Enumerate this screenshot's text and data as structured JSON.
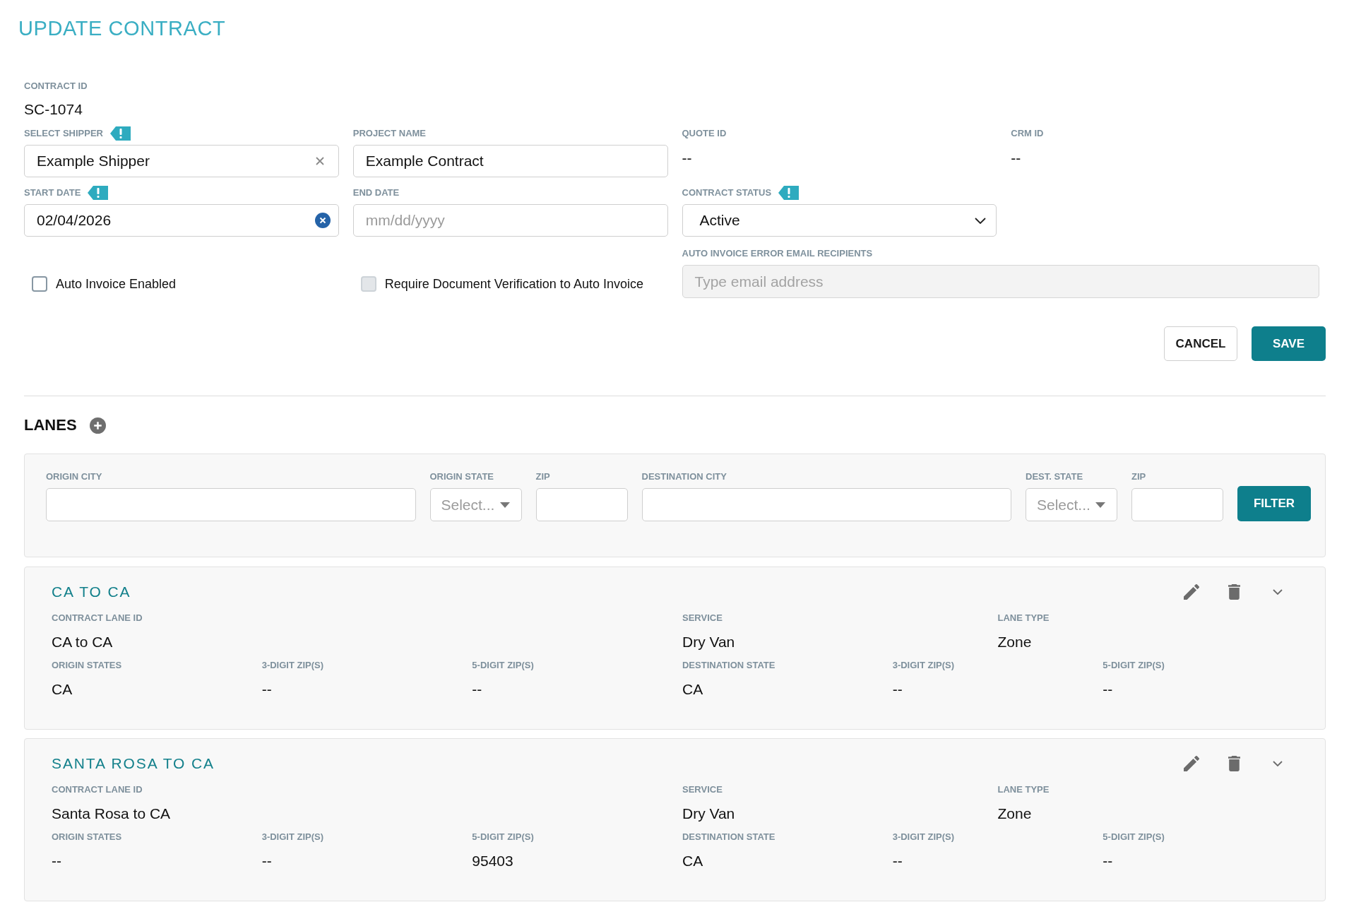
{
  "page": {
    "title": "UPDATE CONTRACT"
  },
  "contract": {
    "id": {
      "label": "CONTRACT ID",
      "value": "SC-1074"
    },
    "rows": [
      [
        {
          "kind": "combobox",
          "label": "SELECT SHIPPER",
          "required": true,
          "value": "Example Shipper"
        },
        {
          "kind": "text",
          "label": "PROJECT NAME",
          "required": false,
          "value": "Example Contract"
        },
        {
          "kind": "readonly",
          "label": "QUOTE ID",
          "required": false,
          "value": "--"
        },
        {
          "kind": "readonly",
          "label": "CRM ID",
          "required": false,
          "value": "--"
        }
      ],
      [
        {
          "kind": "date",
          "label": "START DATE",
          "required": true,
          "value": "02/04/2026"
        },
        {
          "kind": "date",
          "label": "END DATE",
          "required": false,
          "placeholder": "mm/dd/yyyy"
        },
        {
          "kind": "select",
          "label": "CONTRACT STATUS",
          "required": true,
          "value": "Active"
        }
      ],
      [
        {
          "kind": "checkbox",
          "label": "Auto Invoice Enabled",
          "checked": false,
          "disabled": false
        },
        {
          "kind": "checkbox",
          "label": "Require Document Verification to Auto Invoice",
          "checked": false,
          "disabled": true
        },
        {
          "kind": "email",
          "label": "AUTO INVOICE ERROR EMAIL RECIPIENTS",
          "required": false,
          "placeholder": "Type email address",
          "disabled": true
        }
      ]
    ],
    "buttons": [
      {
        "label": "CANCEL",
        "kind": "secondary"
      },
      {
        "label": "SAVE",
        "kind": "primary"
      }
    ]
  },
  "lanes": {
    "title": "LANES",
    "filter": {
      "fields": [
        {
          "kind": "text",
          "label": "ORIGIN CITY"
        },
        {
          "kind": "select",
          "label": "ORIGIN STATE",
          "placeholder": "Select..."
        },
        {
          "kind": "text",
          "label": "ZIP"
        },
        {
          "kind": "text",
          "label": "DESTINATION CITY"
        },
        {
          "kind": "select",
          "label": "DEST. STATE",
          "placeholder": "Select..."
        },
        {
          "kind": "text",
          "label": "ZIP"
        }
      ],
      "button": "FILTER"
    },
    "items": [
      {
        "title": "CA TO CA",
        "summary": [
          {
            "label": "CONTRACT LANE ID",
            "value": "CA to CA"
          },
          {
            "label": "SERVICE",
            "value": "Dry Van"
          },
          {
            "label": "LANE TYPE",
            "value": "Zone"
          }
        ],
        "details": [
          {
            "label": "ORIGIN STATES",
            "value": "CA"
          },
          {
            "label": "3-DIGIT ZIP(S)",
            "value": "--"
          },
          {
            "label": "5-DIGIT ZIP(S)",
            "value": "--"
          },
          {
            "label": "DESTINATION STATE",
            "value": "CA"
          },
          {
            "label": "3-DIGIT ZIP(S)",
            "value": "--"
          },
          {
            "label": "5-DIGIT ZIP(S)",
            "value": "--"
          }
        ]
      },
      {
        "title": "SANTA ROSA TO CA",
        "summary": [
          {
            "label": "CONTRACT LANE ID",
            "value": "Santa Rosa to CA"
          },
          {
            "label": "SERVICE",
            "value": "Dry Van"
          },
          {
            "label": "LANE TYPE",
            "value": "Zone"
          }
        ],
        "details": [
          {
            "label": "ORIGIN STATES",
            "value": "--"
          },
          {
            "label": "3-DIGIT ZIP(S)",
            "value": "--"
          },
          {
            "label": "5-DIGIT ZIP(S)",
            "value": "95403"
          },
          {
            "label": "DESTINATION STATE",
            "value": "CA"
          },
          {
            "label": "3-DIGIT ZIP(S)",
            "value": "--"
          },
          {
            "label": "5-DIGIT ZIP(S)",
            "value": "--"
          }
        ]
      }
    ]
  }
}
